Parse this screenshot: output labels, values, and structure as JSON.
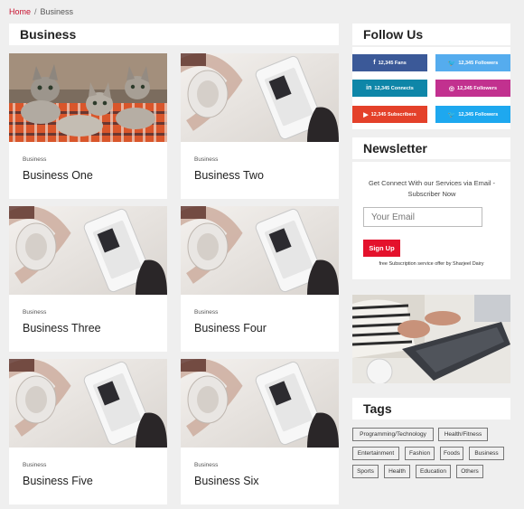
{
  "breadcrumb": {
    "home": "Home",
    "separator": "/",
    "current": "Business"
  },
  "main": {
    "heading": "Business",
    "posts": [
      {
        "category": "Business",
        "title": "Business One",
        "image": "kittens"
      },
      {
        "category": "Business",
        "title": "Business Two",
        "image": "headphones-phone"
      },
      {
        "category": "Business",
        "title": "Business Three",
        "image": "headphones-phone"
      },
      {
        "category": "Business",
        "title": "Business Four",
        "image": "headphones-phone"
      },
      {
        "category": "Business",
        "title": "Business Five",
        "image": "headphones-phone"
      },
      {
        "category": "Business",
        "title": "Business Six",
        "image": "headphones-phone"
      }
    ]
  },
  "sidebar": {
    "follow": {
      "heading": "Follow Us",
      "buttons": [
        {
          "icon": "facebook-icon",
          "glyph": "f",
          "label": "12,345 Fans",
          "color": "#3b5998"
        },
        {
          "icon": "twitter-icon",
          "glyph": "🐦",
          "label": "12,345 Followers",
          "color": "#55acee"
        },
        {
          "icon": "linkedin-icon",
          "glyph": "in",
          "label": "12,345 Connects",
          "color": "#0e86a8"
        },
        {
          "icon": "instagram-icon",
          "glyph": "◎",
          "label": "12,345 Followers",
          "color": "#c2318f"
        },
        {
          "icon": "youtube-icon",
          "glyph": "▶",
          "label": "12,345 Subscribers",
          "color": "#e4412a"
        },
        {
          "icon": "twitter-icon",
          "glyph": "🐦",
          "label": "12,345 Followers",
          "color": "#1ea8ef"
        }
      ]
    },
    "newsletter": {
      "heading": "Newsletter",
      "description": "Get Connect With our Services via Email - Subscriber Now",
      "email_placeholder": "Your Email",
      "button": "Sign Up",
      "offer": "free Subscription service offer by Sharjeel Dairy"
    },
    "tags": {
      "heading": "Tags",
      "items": [
        "Programming/Technology",
        "Health/Fitness",
        "Entertainment",
        "Fashion",
        "Foods",
        "Business",
        "Sports",
        "Health",
        "Education",
        "Others"
      ]
    }
  },
  "colors": {
    "accent": "#e4112c",
    "link": "#c8102e",
    "background": "#efefef"
  }
}
